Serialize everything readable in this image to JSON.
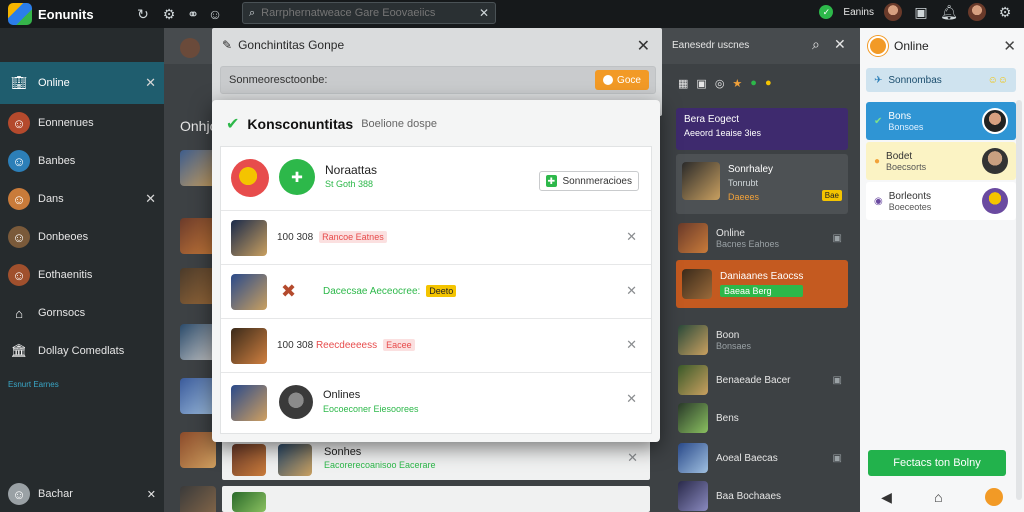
{
  "app": {
    "brand": "Eonunits"
  },
  "topbar": {
    "search_placeholder": "Rarrphernatweace Gare Eoovaeiics",
    "right_label": "Eanins"
  },
  "sidebar": {
    "items": [
      {
        "label": "Online",
        "icon": "building-icon",
        "active": true
      },
      {
        "label": "Eonnenues",
        "icon": "avatar-icon"
      },
      {
        "label": "Banbes",
        "icon": "avatar-icon"
      },
      {
        "label": "Dans",
        "icon": "avatar-icon"
      },
      {
        "label": "Donbeoes",
        "icon": "avatar-icon"
      },
      {
        "label": "Eothaenitis",
        "icon": "avatar-icon"
      },
      {
        "label": "Gornsocs",
        "icon": "home-icon"
      },
      {
        "label": "Dollay Comedlats",
        "icon": "bank-icon"
      }
    ],
    "section_label": "Esnurt Earnes",
    "footer_label": "Bachar"
  },
  "background": {
    "label": "Onhjo",
    "header_text": "Eanesedr uscnes"
  },
  "modal_outer": {
    "title": "Gonchintitas Gonpe",
    "search_value": "Sonmeoresctoonbe:",
    "button_label": "Goce"
  },
  "modal_inner": {
    "title": "Konsconuntitas",
    "subtitle": "Boelione dospe",
    "featured": {
      "name": "Noraattas",
      "meta": "St Goth 388",
      "action_label": "Sonnmeracioes"
    },
    "rows": [
      {
        "prefix": "100 308",
        "tag": "Rancoe Eatnes",
        "tag_color": "#e74c4c"
      },
      {
        "prefix": "",
        "text": "Dacecsae Aeceocree:",
        "tag": "Deeto",
        "tag_color": "#f4c400"
      },
      {
        "prefix": "100 308",
        "text": "Reecdeeeess",
        "tag": "Eacee",
        "tag_color": "#e74c4c"
      },
      {
        "prefix": "",
        "title": "Onlines",
        "text": "Eocoeconer Eiesoorees"
      }
    ]
  },
  "behind_rows": [
    {
      "title": "Sonhes",
      "text": "Eacorerecoanisoo Eacerare"
    },
    {
      "title": "",
      "text": ""
    }
  ],
  "right_column": {
    "banner_line1": "Bera Eogect",
    "banner_line2": "Aeeord 1eaise 3ies",
    "card_title": "Sonrhaley",
    "card_sub": "Tonrubt",
    "card_sub2": "Daeees",
    "card_badge": "Bae",
    "items": [
      {
        "title": "Online",
        "sub": "Bacnes Eahoes"
      },
      {
        "title": "Daniaanes Eaocss",
        "sub": "Baeaa Berg",
        "highlight": true
      },
      {
        "title": "Boon",
        "sub": "Bonsaes"
      },
      {
        "title": "Benaeade Bacer",
        "sub": ""
      },
      {
        "title": "Bens",
        "sub": ""
      },
      {
        "title": "Aoeal Baecas",
        "sub": ""
      },
      {
        "title": "Baa Bochaaes",
        "sub": ""
      }
    ]
  },
  "far_right": {
    "title": "Online",
    "banner": "Sonnombas",
    "items": [
      {
        "title": "Bons",
        "sub": "Bonsoes",
        "bg": "#2f95d4"
      },
      {
        "title": "Bodet",
        "sub": "Boecsorts",
        "bg": "#fbf3c4"
      },
      {
        "title": "Borleonts",
        "sub": "Boeceotes",
        "bg": "#ffffff"
      }
    ],
    "cta": "Fectacs ton Bolny"
  }
}
